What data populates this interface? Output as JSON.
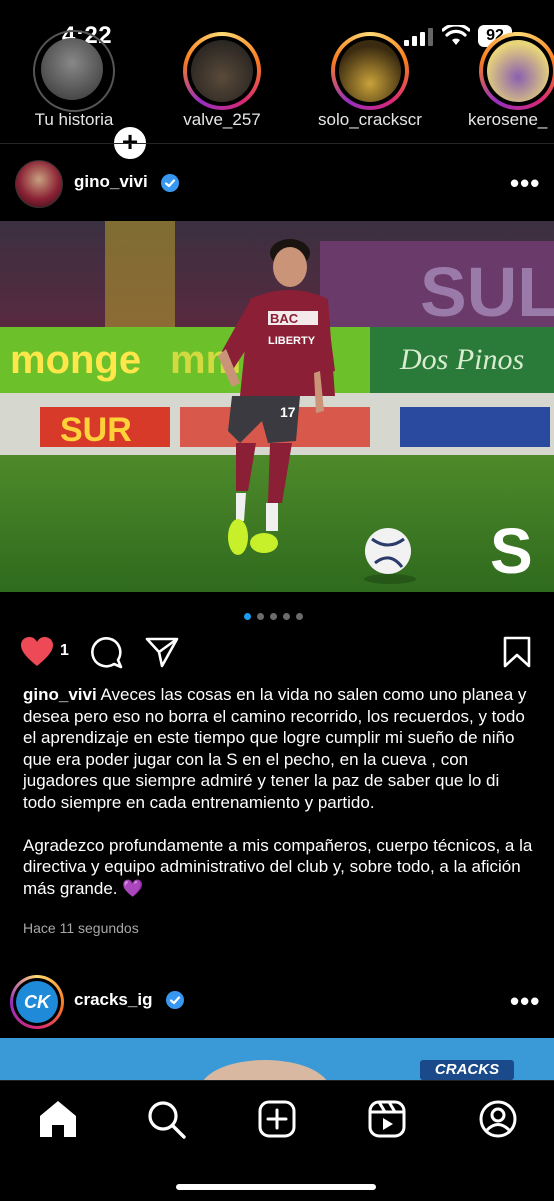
{
  "status_bar": {
    "time": "4:22",
    "battery": "92"
  },
  "stories": [
    {
      "label": "Tu historia",
      "ring": "seen"
    },
    {
      "label": "valve_257",
      "ring": "new"
    },
    {
      "label": "solo_crackscr",
      "ring": "new"
    },
    {
      "label": "kerosene_",
      "ring": "new"
    }
  ],
  "post1": {
    "username": "gino_vivi",
    "verified": true,
    "likes": "1",
    "carousel_count": 5,
    "carousel_active": 1,
    "photo_banner_texts": [
      "monge",
      "SUR",
      "BAC",
      "LIBERTY",
      "17",
      "S"
    ],
    "caption_user": "gino_vivi",
    "caption_p1": "Aveces las cosas en la vida no salen como uno planea y desea pero eso no borra el camino recorrido, los recuerdos, y todo el aprendizaje en este tiempo que logre cumplir mi sueño de niño que era poder jugar con la S en el pecho, en la cueva , con jugadores que siempre admiré y tener la paz de saber que lo di todo siempre en cada entrenamiento y partido.",
    "caption_p2": "Agradezco profundamente a mis compañeros, cuerpo técnicos, a la directiva y equipo administrativo del club y, sobre todo, a la afición más grande. 💜",
    "time_ago": "Hace 11 segundos"
  },
  "post2": {
    "username": "cracks_ig",
    "verified": true,
    "avatar_text": "CK",
    "banner_text": "CRACKS"
  },
  "tabbar": [
    "home-icon",
    "search-icon",
    "create-icon",
    "reels-icon",
    "profile-icon"
  ],
  "colors": {
    "like": "#ed4956",
    "verified": "#3897f0",
    "dot_active": "#1d9bf0"
  }
}
